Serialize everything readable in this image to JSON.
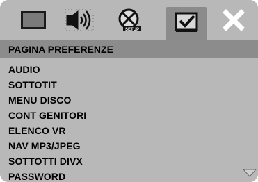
{
  "toolbar": {
    "tabs": [
      {
        "icon": "screen-icon"
      },
      {
        "icon": "speaker-audio-icon"
      },
      {
        "icon": "disc-features-icon"
      },
      {
        "icon": "preferences-checkbox-icon",
        "active": true
      },
      {
        "icon": "close-icon"
      }
    ]
  },
  "page": {
    "title": "PAGINA PREFERENZE"
  },
  "menu": {
    "items": [
      {
        "label": "AUDIO"
      },
      {
        "label": "SOTTOTIT"
      },
      {
        "label": "MENU DISCO"
      },
      {
        "label": "CONT GENITORI"
      },
      {
        "label": "ELENCO VR"
      },
      {
        "label": "NAV MP3/JPEG"
      },
      {
        "label": "SOTTOTTI DIVX"
      },
      {
        "label": "PASSWORD"
      }
    ],
    "scroll_icon": "scroll-down-arrow-icon"
  },
  "colors": {
    "background": "#b8b8b8",
    "title_bar": "#8c8c8c",
    "active_tab": "#8b8b8b",
    "text": "#000000"
  }
}
